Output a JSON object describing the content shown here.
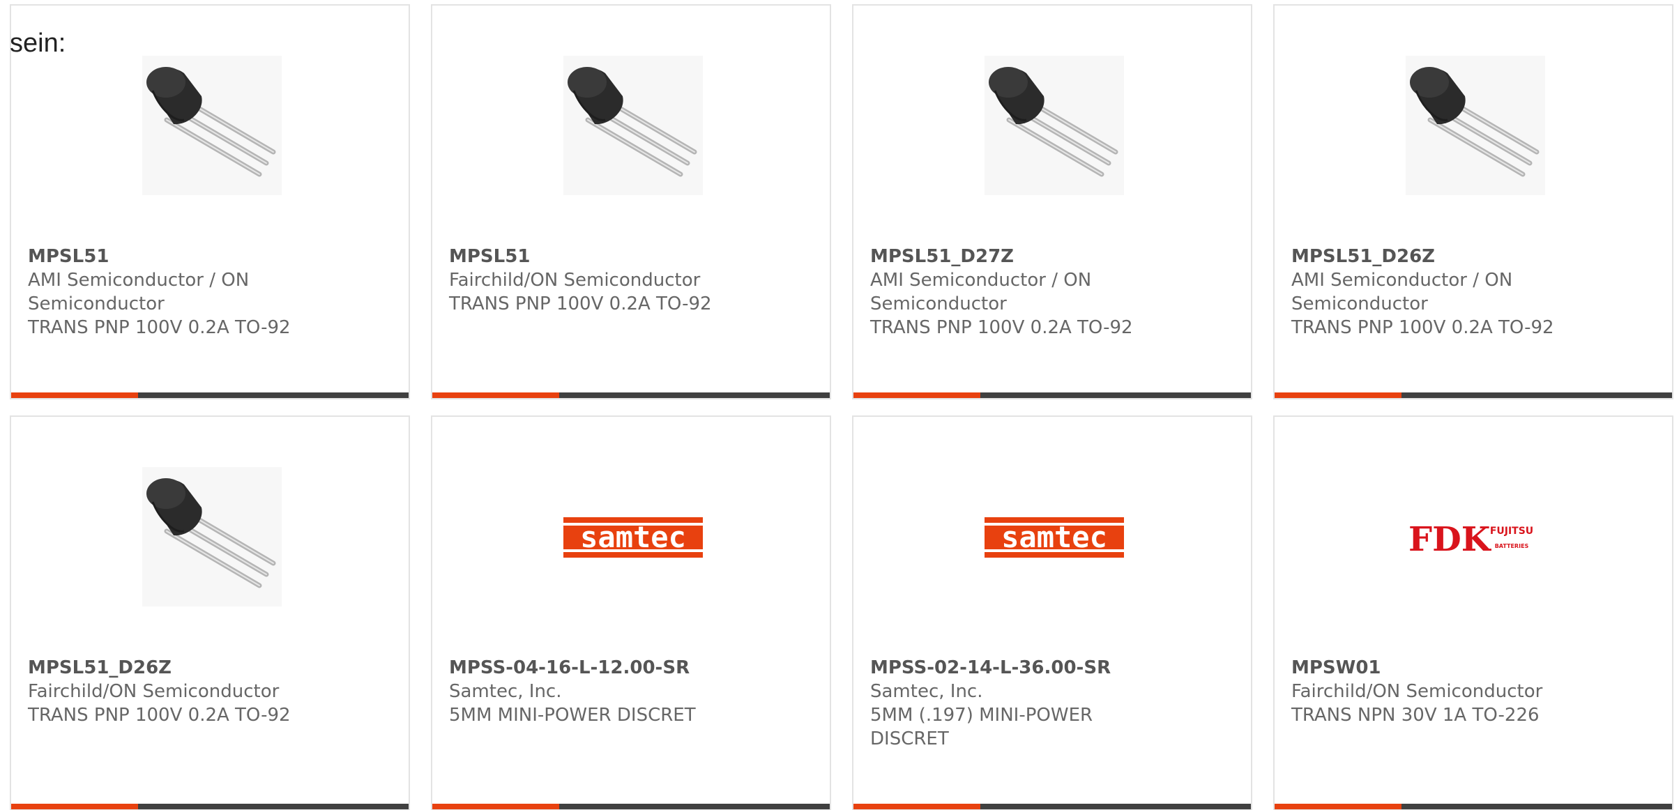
{
  "lead_text": "sein:",
  "colors": {
    "accent_bar": "#e8410f",
    "bar_dark": "#404040",
    "samtec_logo": "#e8410f",
    "fdk_logo": "#d9141c"
  },
  "cards": [
    {
      "part_number": "MPSL51",
      "manufacturer": "AMI Semiconductor / ON Semiconductor",
      "description": "TRANS PNP 100V 0.2A TO-92",
      "image": "transistor-to92-image"
    },
    {
      "part_number": "MPSL51",
      "manufacturer": "Fairchild/ON Semiconductor",
      "description": "TRANS PNP 100V 0.2A TO-92",
      "image": "transistor-to92-image"
    },
    {
      "part_number": "MPSL51_D27Z",
      "manufacturer": "AMI Semiconductor / ON Semiconductor",
      "description": "TRANS PNP 100V 0.2A TO-92",
      "image": "transistor-to92-image"
    },
    {
      "part_number": "MPSL51_D26Z",
      "manufacturer": "AMI Semiconductor / ON Semiconductor",
      "description": "TRANS PNP 100V 0.2A TO-92",
      "image": "transistor-to92-image"
    },
    {
      "part_number": "MPSL51_D26Z",
      "manufacturer": "Fairchild/ON Semiconductor",
      "description": "TRANS PNP 100V 0.2A TO-92",
      "image": "transistor-to92-image"
    },
    {
      "part_number": "MPSS-04-16-L-12.00-SR",
      "manufacturer": "Samtec, Inc.",
      "description": "5MM MINI-POWER DISCRET",
      "image": "samtec-logo",
      "logo_text": "samtec"
    },
    {
      "part_number": "MPSS-02-14-L-36.00-SR",
      "manufacturer": "Samtec, Inc.",
      "description": "5MM (.197) MINI-POWER DISCRET",
      "image": "samtec-logo",
      "logo_text": "samtec"
    },
    {
      "part_number": "MPSW01",
      "manufacturer": "Fairchild/ON Semiconductor",
      "description": "TRANS NPN 30V 1A TO-226",
      "image": "fdk-logo",
      "logo_text": "FDK",
      "logo_subtext_top": "FUJITSU",
      "logo_subtext_bottom": "BATTERIES"
    }
  ]
}
